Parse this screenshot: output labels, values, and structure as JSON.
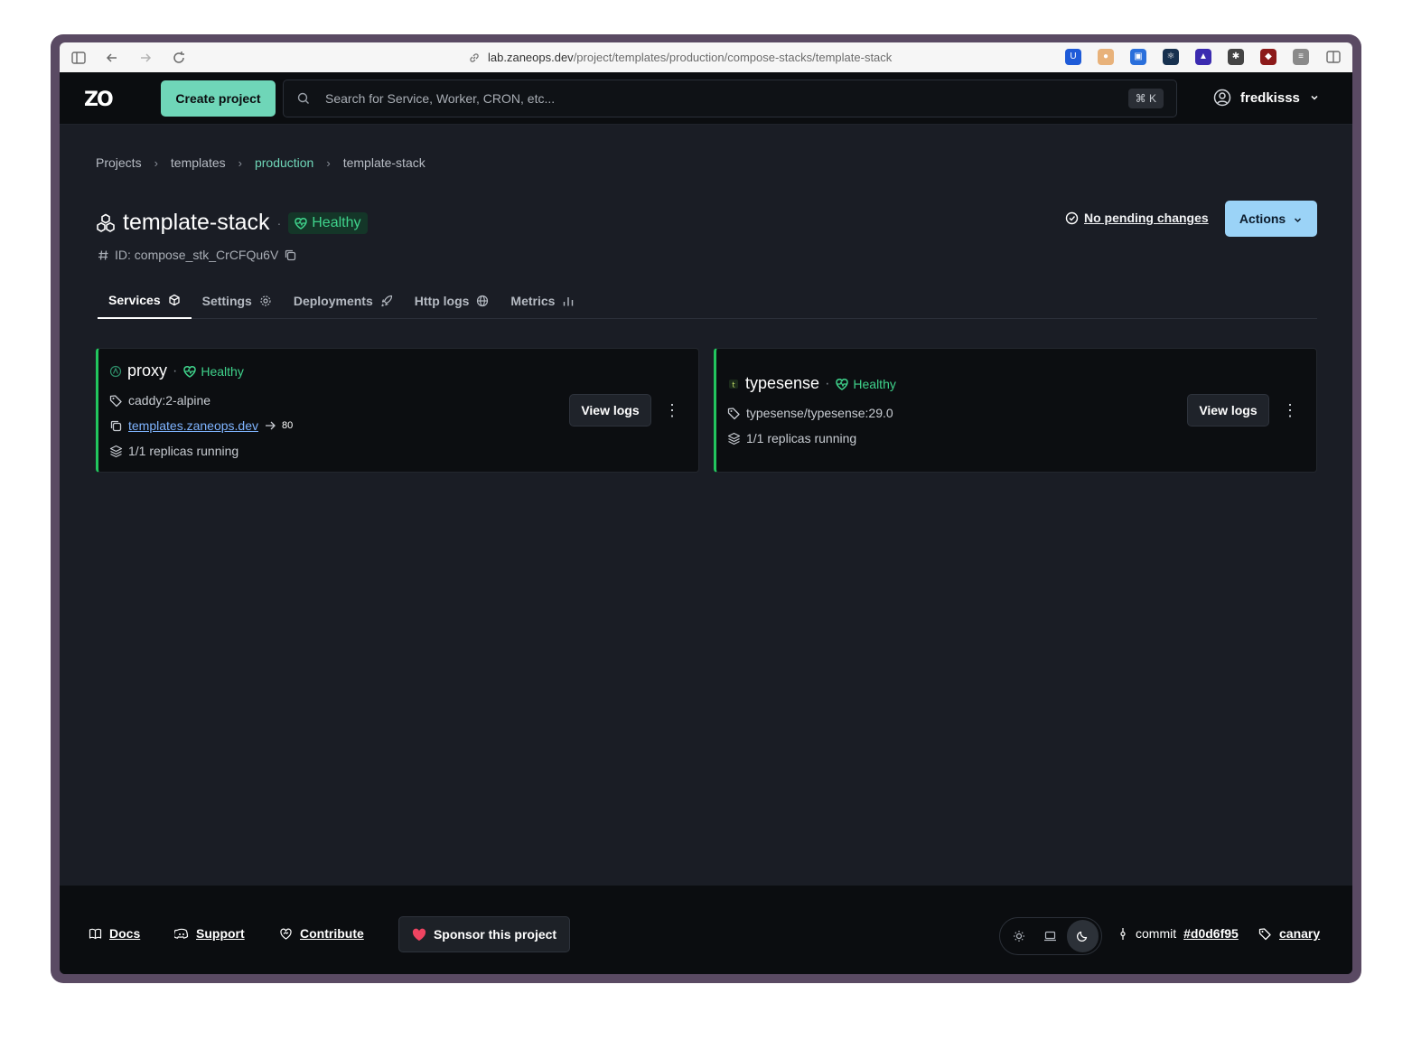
{
  "browser": {
    "url_host": "lab.zaneops.dev",
    "url_path": "/project/templates/production/compose-stacks/template-stack"
  },
  "header": {
    "logo_text": "ZO",
    "create_label": "Create project",
    "search_placeholder": "Search for Service, Worker, CRON, etc...",
    "search_shortcut": "⌘ K",
    "username": "fredkisss"
  },
  "breadcrumb": [
    "Projects",
    "templates",
    "production",
    "template-stack"
  ],
  "stack": {
    "title": "template-stack",
    "status": "Healthy",
    "id_label": "ID: compose_stk_CrCFQu6V",
    "pending_label": "No pending changes",
    "actions_label": "Actions"
  },
  "tabs": [
    "Services",
    "Settings",
    "Deployments",
    "Http logs",
    "Metrics"
  ],
  "services": [
    {
      "name": "proxy",
      "status": "Healthy",
      "image": "caddy:2-alpine",
      "domain": "templates.zaneops.dev",
      "port": "80",
      "replicas": "1/1 replicas running",
      "view_logs": "View logs"
    },
    {
      "name": "typesense",
      "status": "Healthy",
      "image": "typesense/typesense:29.0",
      "replicas": "1/1 replicas running",
      "view_logs": "View logs"
    }
  ],
  "footer": {
    "docs": "Docs",
    "support": "Support",
    "contribute": "Contribute",
    "sponsor": "Sponsor this project",
    "commit_label": "commit",
    "commit_hash": "#d0d6f95",
    "channel": "canary"
  },
  "colors": {
    "accent": "#6fd6b8",
    "healthy": "#3fd28b",
    "actions": "#9bd3f7",
    "background": "#1a1d25"
  }
}
